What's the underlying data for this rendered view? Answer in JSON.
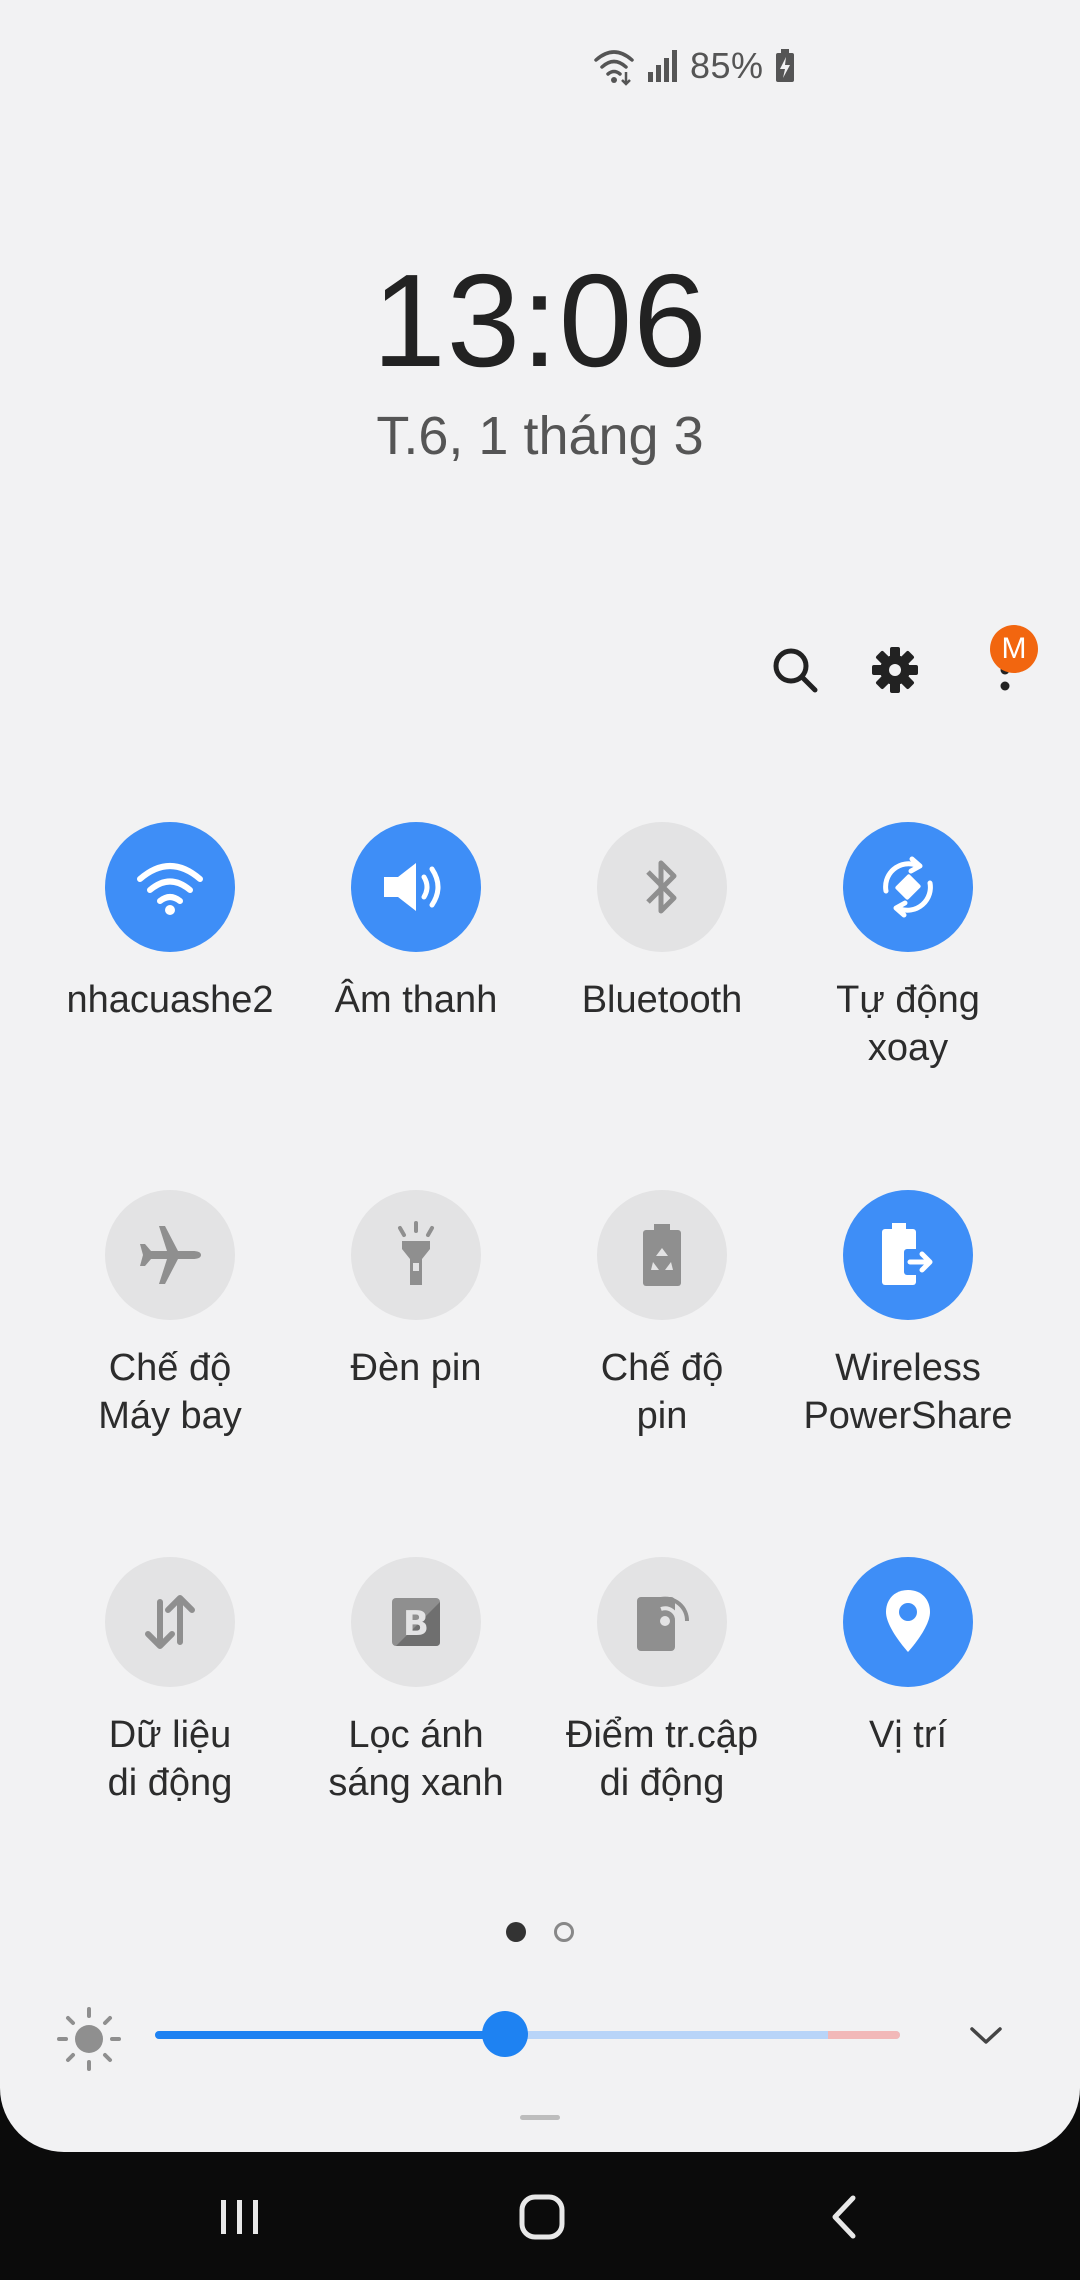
{
  "status_bar": {
    "battery_percent": "85%",
    "icons": [
      "wifi-icon",
      "signal-icon",
      "battery-charging-icon"
    ]
  },
  "lockscreen": {
    "time": "13:06",
    "date": "T.6, 1 tháng 3"
  },
  "top_actions": {
    "icons": [
      "search-icon",
      "settings-icon",
      "more-options-icon"
    ],
    "badge": "M",
    "badge_color": "#f2660f"
  },
  "tiles": [
    {
      "label": "nhacuashe2",
      "icon": "wifi-icon",
      "on": true
    },
    {
      "label": "Âm thanh",
      "icon": "sound-icon",
      "on": true
    },
    {
      "label": "Bluetooth",
      "icon": "bluetooth-icon",
      "on": false
    },
    {
      "label": "Tự động\nxoay",
      "icon": "auto-rotate-icon",
      "on": true
    },
    {
      "label": "Chế độ\nMáy bay",
      "icon": "airplane-icon",
      "on": false
    },
    {
      "label": "Đèn pin",
      "icon": "flashlight-icon",
      "on": false
    },
    {
      "label": "Chế độ\npin",
      "icon": "power-saving-icon",
      "on": false
    },
    {
      "label": "Wireless\nPowerShare",
      "icon": "wireless-powershare-icon",
      "on": true
    },
    {
      "label": "Dữ liệu\ndi động",
      "icon": "mobile-data-icon",
      "on": false
    },
    {
      "label": "Lọc ánh\nsáng xanh",
      "icon": "blue-light-filter-icon",
      "on": false
    },
    {
      "label": "Điểm tr.cập\ndi động",
      "icon": "mobile-hotspot-icon",
      "on": false
    },
    {
      "label": "Vị trí",
      "icon": "location-icon",
      "on": true
    }
  ],
  "pagination": {
    "current": 1,
    "total": 2
  },
  "brightness": {
    "level": 0.47,
    "accent": "#1e82f2"
  },
  "colors": {
    "tile_on": "#3e8ef7",
    "tile_off": "#e3e3e4",
    "panel_bg": "#f2f2f3"
  },
  "navigation": {
    "icons": [
      "recents-icon",
      "home-icon",
      "back-icon"
    ]
  }
}
